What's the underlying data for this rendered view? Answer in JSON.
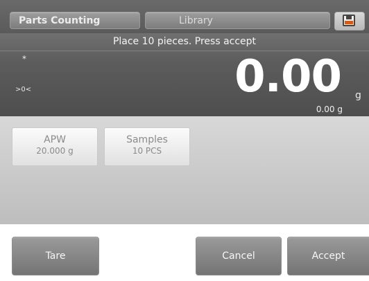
{
  "header": {
    "app_tab": "Parts Counting",
    "library_tab": "Library",
    "save_icon": "save-floppy-icon"
  },
  "display": {
    "prompt": "Place 10 pieces.  Press accept",
    "stable_indicator": "*",
    "zero_indicator": ">0<",
    "main_value": "0.00",
    "main_unit": "g",
    "secondary_value": "0.00 g"
  },
  "reference": {
    "apw": {
      "title": "APW",
      "value": "20.000 g"
    },
    "samples": {
      "title": "Samples",
      "value": "10 PCS"
    }
  },
  "actions": {
    "tare": "Tare",
    "cancel": "Cancel",
    "accept": "Accept"
  }
}
